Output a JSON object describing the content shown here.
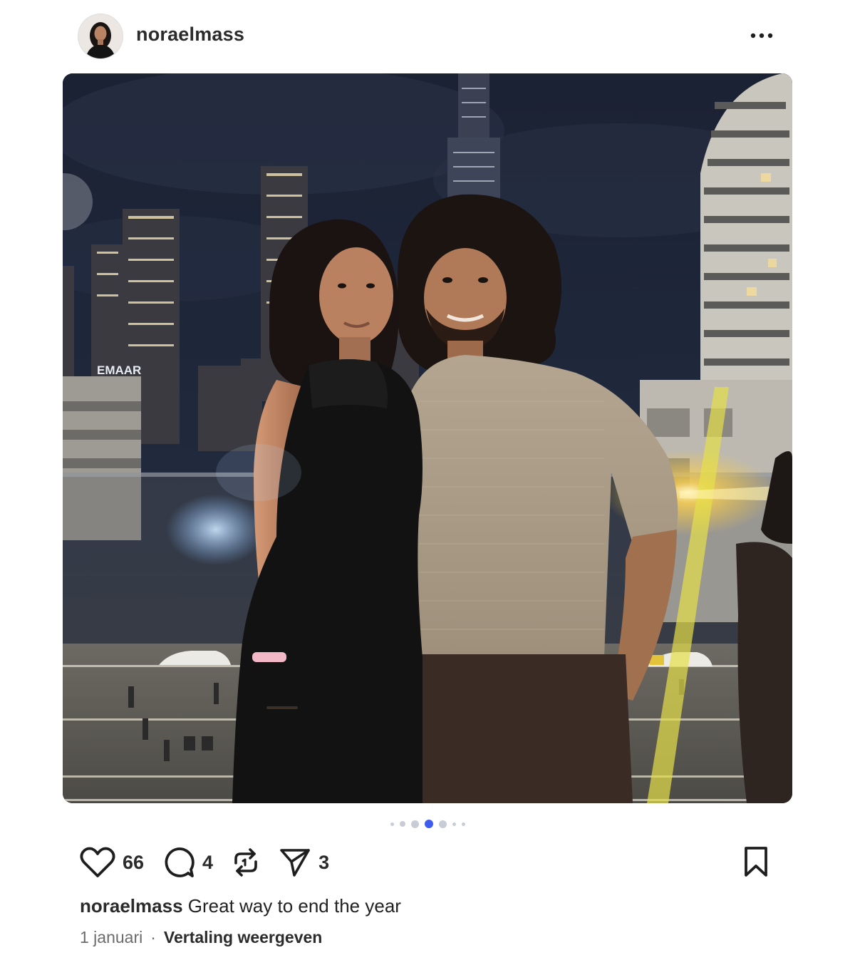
{
  "post": {
    "author": "noraelmass",
    "more_icon": "more-horizontal-icon",
    "carousel": {
      "total": 7,
      "active_index": 3
    },
    "actions": {
      "like_count": "66",
      "comment_count": "4",
      "share_count": "3",
      "icons": [
        "heart-icon",
        "comment-icon",
        "repost-icon",
        "send-icon",
        "bookmark-icon"
      ]
    },
    "caption": {
      "user": "noraelmass",
      "text": "Great way to end the year"
    },
    "meta": {
      "date": "1 januari",
      "separator": "·",
      "translate_label": "Vertaling weergeven"
    },
    "photo": {
      "sign_text": "EMAAR"
    }
  },
  "colors": {
    "accent_dot": "#3f5cf0",
    "inactive_dot": "#c7ccd6",
    "text": "#2b2b2b",
    "muted": "#6b6b6b"
  }
}
